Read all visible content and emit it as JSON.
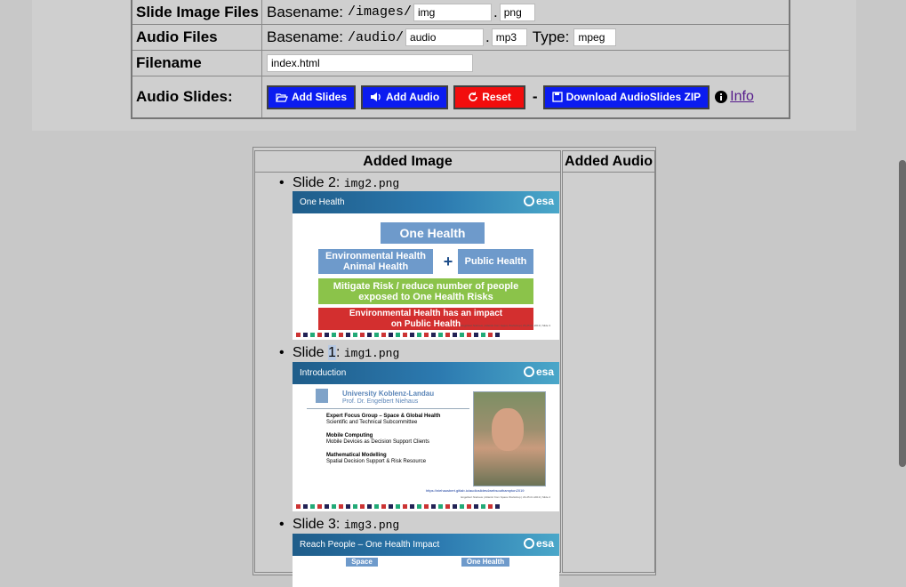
{
  "form": {
    "slide_image_files": {
      "label": "Slide Image Files",
      "prefix_text": "Basename:",
      "path": "/images/",
      "basename": "img",
      "dot": ".",
      "extension": "png"
    },
    "audio_files": {
      "label": "Audio Files",
      "prefix_text": "Basename:",
      "path": "/audio/",
      "basename": "audio",
      "dot": ".",
      "extension": "mp3",
      "type_label": "Type:",
      "type_value": "mpeg"
    },
    "filename": {
      "label": "Filename",
      "value": "index.html"
    },
    "audio_slides": {
      "label": "Audio Slides:",
      "add_slides": "Add Slides",
      "add_audio": "Add Audio",
      "reset": "Reset",
      "separator": "-",
      "download": "Download AudioSlides ZIP",
      "info": "Info"
    }
  },
  "results": {
    "header_image": "Added Image",
    "header_audio": "Added Audio",
    "slides": [
      {
        "label": "Slide 2:",
        "file": "img2.png",
        "thumb_title": "One Health",
        "boxes": [
          "One Health",
          "Environmental Health Animal Health",
          "+",
          "Public Health",
          "Mitigate Risk / reduce number of people exposed to One Health Risks",
          "Environmental Health has an impact on Public Health"
        ],
        "footer": "Engelbert Niehaus | Atlantic from Space Workshop | 23-25.01.2019 | Slide 3"
      },
      {
        "label_pre": "Slide ",
        "label_num": "1",
        "label_post": ":",
        "file": "img1.png",
        "thumb_title": "Introduction",
        "university": "University Koblenz-Landau",
        "professor": "Prof. Dr. Engelbert Niehaus",
        "items": [
          {
            "title": "Expert Focus Group – Space & Global Health",
            "text": "Scientific and Technical Subcommittee"
          },
          {
            "title": "Mobile Computing",
            "text": "Mobile Devices as Decision Support Clients"
          },
          {
            "title": "Mathematical Modelling",
            "text": "Spatial Decision Support & Risk Resource"
          }
        ],
        "link": "https://niehausbert.gitlab.io/audioslides4websouthampton2019",
        "footer": "Engelbert Niehaus | Atlantic from Space Workshop | 23-25.01.2019 | Slide 2"
      },
      {
        "label": "Slide 3:",
        "file": "img3.png",
        "thumb_title": "Reach People – One Health Impact",
        "boxes": [
          "Space",
          "One Health"
        ]
      }
    ],
    "esa": "esa"
  },
  "colors": {
    "button_blue": "#0b1cf0",
    "button_red": "#f20d0d",
    "link": "#551a8b"
  },
  "icons": [
    "folder-open-icon",
    "speaker-icon",
    "refresh-icon",
    "floppy-disk-icon",
    "info-icon"
  ]
}
